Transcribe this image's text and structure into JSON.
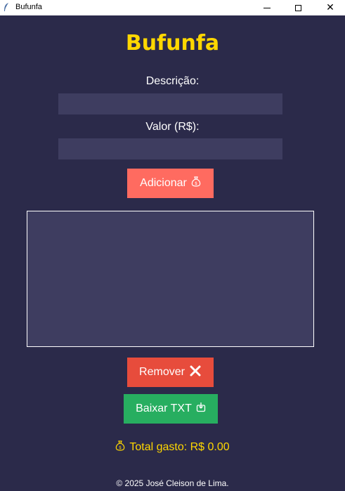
{
  "window": {
    "title": "Bufunfa",
    "close_glyph": "✕"
  },
  "app": {
    "title": "Bufunfa"
  },
  "form": {
    "description_label": "Descrição:",
    "description_value": "",
    "value_label": "Valor (R$):",
    "value_value": ""
  },
  "buttons": {
    "add_label": "Adicionar",
    "add_icon": "money-bag-icon",
    "remove_label": "Remover",
    "remove_icon": "cross-mark-icon",
    "download_label": "Baixar TXT",
    "download_icon": "download-box-icon"
  },
  "expenses": [],
  "summary": {
    "total_label": "Total gasto: R$ 0.00",
    "total_icon": "money-bag-icon"
  },
  "footer": {
    "text": "© 2025 José Cleison de Lima."
  },
  "colors": {
    "background": "#2b2a4a",
    "field": "#3e3d60",
    "title": "#ffd700",
    "add_button": "#ff6b60",
    "remove_button": "#e74c3c",
    "download_button": "#27ae60"
  }
}
